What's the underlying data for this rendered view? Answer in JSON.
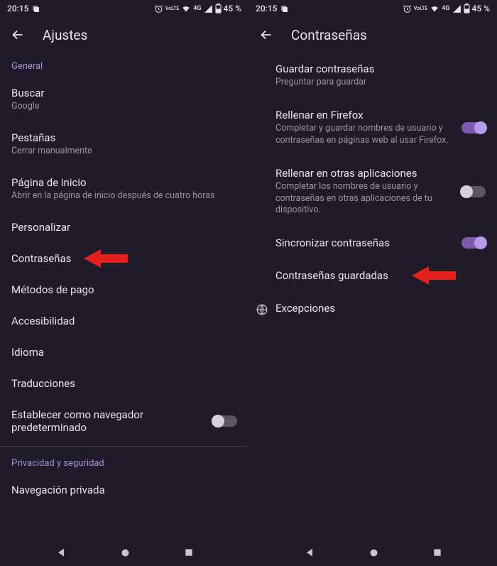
{
  "status": {
    "time": "20:15",
    "battery": "45 %",
    "network": "4G",
    "lte": "VoLTE"
  },
  "left": {
    "title": "Ajustes",
    "section1": "General",
    "items": [
      {
        "title": "Buscar",
        "sub": "Google"
      },
      {
        "title": "Pestañas",
        "sub": "Cerrar manualmente"
      },
      {
        "title": "Página de inicio",
        "sub": "Abrir en la página de inicio después de cuatro horas"
      },
      {
        "title": "Personalizar"
      },
      {
        "title": "Contraseñas"
      },
      {
        "title": "Métodos de pago"
      },
      {
        "title": "Accesibilidad"
      },
      {
        "title": "Idioma"
      },
      {
        "title": "Traducciones"
      },
      {
        "title": "Establecer como navegador predeterminado"
      }
    ],
    "section2": "Privacidad y seguridad",
    "items2": [
      {
        "title": "Navegación privada"
      }
    ]
  },
  "right": {
    "title": "Contraseñas",
    "items": [
      {
        "title": "Guardar contraseñas",
        "sub": "Preguntar para guardar"
      },
      {
        "title": "Rellenar en Firefox",
        "sub": "Completar y guardar nombres de usuario y contraseñas en páginas web al usar Firefox."
      },
      {
        "title": "Rellenar en otras aplicaciones",
        "sub": "Completar los nombres de usuario y contraseñas en otras aplicaciones de tu dispositivo."
      },
      {
        "title": "Sincronizar contraseñas"
      },
      {
        "title": "Contraseñas guardadas"
      },
      {
        "title": "Excepciones"
      }
    ]
  }
}
